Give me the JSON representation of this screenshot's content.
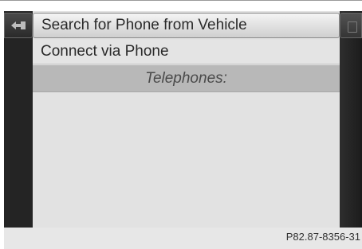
{
  "menu": {
    "items": [
      {
        "label": "Search for Phone from Vehicle",
        "selected": true
      },
      {
        "label": "Connect via Phone",
        "selected": false
      }
    ],
    "section_header": "Telephones:"
  },
  "icons": {
    "back": "back-arrow-icon",
    "right": "side-panel-icon"
  },
  "figure_code": "P82.87-8356-31"
}
